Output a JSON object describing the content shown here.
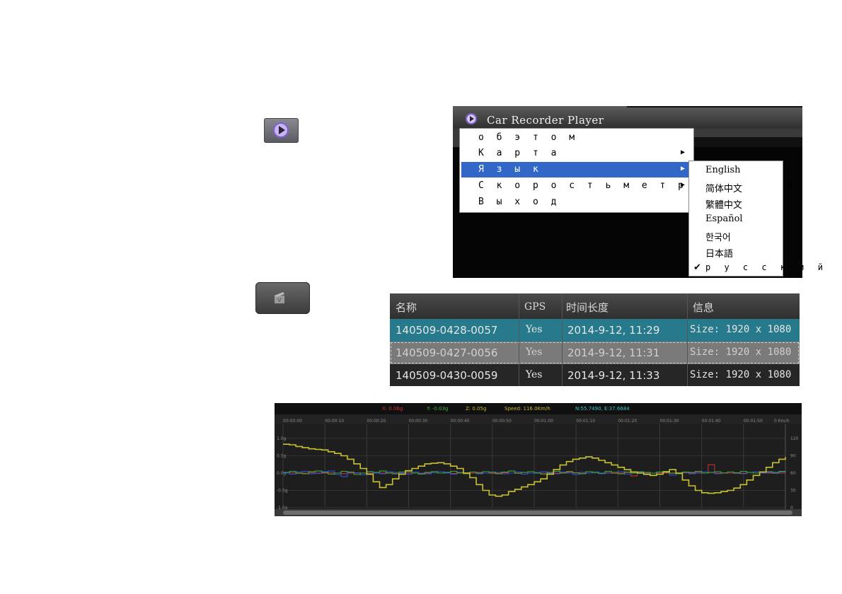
{
  "window": {
    "title": "Car Recorder Player"
  },
  "menu": {
    "items": [
      {
        "label": "о б э т о м",
        "has_submenu": false
      },
      {
        "label": "К а р т а",
        "has_submenu": true
      },
      {
        "label": "Я з ы к",
        "has_submenu": true,
        "selected": true
      },
      {
        "label": "С к о р о с т ь м е т р о л о г и и",
        "has_submenu": true
      },
      {
        "label": "В ы х о д",
        "has_submenu": false
      }
    ]
  },
  "language_submenu": {
    "items": [
      {
        "label": "English",
        "checked": false
      },
      {
        "label": "简体中文",
        "checked": false
      },
      {
        "label": "繁體中文",
        "checked": false
      },
      {
        "label": "Español",
        "checked": false
      },
      {
        "label": "한국어",
        "checked": false
      },
      {
        "label": "日本語",
        "checked": false
      },
      {
        "label": "р у с с к и й",
        "checked": true
      }
    ],
    "check_glyph": "✔"
  },
  "file_table": {
    "headers": [
      "名称",
      "GPS",
      "时间长度",
      "信息"
    ],
    "rows": [
      {
        "name": "140509-0428-0057",
        "gps": "Yes",
        "time": "2014-9-12, 11:29",
        "info": "Size: 1920 x 1080"
      },
      {
        "name": "140509-0427-0056",
        "gps": "Yes",
        "time": "2014-9-12, 11:31",
        "info": "Size: 1920 x 1080"
      },
      {
        "name": "140509-0430-0059",
        "gps": "Yes",
        "time": "2014-9-12, 11:33",
        "info": "Size: 1920 x 1080"
      }
    ],
    "colors": {
      "selected_row": "#267a8c",
      "focused_row": "#7a7a7a"
    }
  },
  "icons": {
    "play_button": "play-icon",
    "clapper_button": "clapperboard-icon"
  },
  "chart_data": {
    "type": "line",
    "legend_readout": {
      "x": "X: 0.06g",
      "y": "Y: -0.03g",
      "z": "Z: 0.05g",
      "speed": "Speed: 116.0Km/h",
      "gps": "N:55.7490, E:37.6684"
    },
    "x_ticks": [
      "00:00:00",
      "00:00:10",
      "00:00:20",
      "00:00:30",
      "00:00:40",
      "00:00:50",
      "00:01:00",
      "00:01:10",
      "00:01:20",
      "00:01:30",
      "00:01:40",
      "00:01:50"
    ],
    "x_unit": "0 Km/h",
    "y_left_ticks": [
      "1.0g",
      "0.5g",
      "0.0g",
      "-0.5g",
      "-1.0g"
    ],
    "y_right_ticks": [
      "120",
      "90",
      "60",
      "30",
      "0"
    ],
    "ylim_left": [
      -1.0,
      1.0
    ],
    "ylim_right": [
      0,
      120
    ],
    "series": [
      {
        "color": "#c8c230",
        "axis": "right",
        "values": [
          110,
          109,
          106,
          104,
          102,
          101,
          100,
          97,
          94,
          90,
          84,
          76,
          68,
          58,
          45,
          35,
          40,
          50,
          58,
          64,
          68,
          72,
          76,
          77,
          78,
          76,
          72,
          68,
          60,
          52,
          40,
          30,
          22,
          20,
          22,
          28,
          32,
          36,
          40,
          45,
          50,
          58,
          66,
          74,
          80,
          84,
          86,
          88,
          86,
          82,
          78,
          74,
          70,
          66,
          62,
          60,
          58,
          56,
          58,
          62,
          66,
          60,
          48,
          38,
          30,
          26,
          25,
          26,
          28,
          30,
          34,
          40,
          48,
          56,
          62,
          70,
          78,
          84,
          88
        ]
      },
      {
        "color": "#3ea83e",
        "axis": "left",
        "values": [
          0.02,
          0.05,
          0.0,
          -0.02,
          0.04,
          0.06,
          0.02,
          -0.03,
          0.0,
          0.05,
          0.03,
          -0.04,
          0.0,
          0.04,
          0.02,
          0.06,
          0.0,
          -0.02,
          0.03,
          0.05,
          0.0,
          -0.03,
          0.02,
          0.04,
          0.0,
          0.02,
          0.05,
          0.01,
          -0.02,
          0.03,
          0.0,
          0.04,
          0.02,
          -0.02,
          0.03,
          0.06,
          0.0,
          0.02,
          0.04,
          0.0,
          -0.03,
          0.02,
          0.05,
          0.0,
          0.03,
          0.01,
          -0.02,
          0.04,
          0.02,
          0.0,
          0.05,
          0.02,
          -0.02,
          0.03,
          0.0,
          0.04,
          0.02,
          0.0,
          0.03,
          0.05,
          0.0,
          -0.02,
          0.03,
          0.02,
          0.05,
          0.0,
          0.02,
          0.04,
          0.0,
          0.03,
          0.01,
          0.05,
          0.02,
          0.0,
          0.03,
          0.04,
          0.02,
          0.05,
          0.03
        ]
      },
      {
        "color": "#3050d8",
        "axis": "left",
        "values": [
          0.0,
          -0.03,
          0.03,
          0.05,
          -0.02,
          0.0,
          0.04,
          0.06,
          -0.04,
          -0.1,
          0.02,
          0.0,
          -0.05,
          0.03,
          0.0,
          -0.02,
          0.04,
          0.02,
          0.0,
          -0.03,
          0.03,
          0.0,
          -0.02,
          0.02,
          0.04,
          0.0,
          -0.03,
          0.02,
          0.0,
          0.03,
          -0.02,
          0.0,
          0.03,
          0.02,
          -0.02,
          0.0,
          0.03,
          -0.03,
          0.0,
          0.02,
          0.04,
          0.0,
          -0.02,
          0.03,
          0.0,
          -0.04,
          0.02,
          0.0,
          0.03,
          -0.02,
          0.0,
          0.02,
          0.04,
          -0.03,
          0.0,
          0.02,
          -0.05,
          0.0,
          0.03,
          0.02,
          -0.06,
          0.0,
          0.02,
          -0.02,
          0.0,
          0.03,
          0.02,
          -0.02,
          0.0,
          0.03,
          0.0,
          -0.02,
          0.02,
          0.04,
          0.0,
          0.02,
          0.0,
          0.03,
          0.01
        ]
      },
      {
        "color": "#c03030",
        "axis": "left",
        "values": [
          0.0,
          0.01,
          -0.01,
          0.0,
          0.02,
          -0.01,
          0.0,
          0.01,
          0.0,
          -0.02,
          0.0,
          0.01,
          0.0,
          -0.01,
          0.02,
          0.0,
          0.01,
          -0.01,
          0.0,
          0.01,
          0.0,
          -0.01,
          0.0,
          0.02,
          0.0,
          0.01,
          -0.01,
          0.0,
          0.01,
          0.0,
          0.02,
          0.0,
          -0.01,
          0.0,
          0.01,
          0.0,
          -0.01,
          0.02,
          0.0,
          0.01,
          0.0,
          -0.01,
          0.0,
          0.01,
          0.05,
          0.0,
          -0.01,
          0.0,
          0.02,
          0.0,
          0.01,
          -0.01,
          0.0,
          0.02,
          -0.08,
          0.0,
          0.01,
          0.0,
          0.02,
          0.0,
          -0.01,
          0.0,
          0.01,
          0.0,
          0.02,
          0.0,
          0.24,
          0.0,
          0.01,
          0.0,
          -0.01,
          0.0,
          0.02,
          0.0,
          0.01,
          0.0,
          -0.01,
          0.0,
          0.01
        ]
      }
    ]
  }
}
